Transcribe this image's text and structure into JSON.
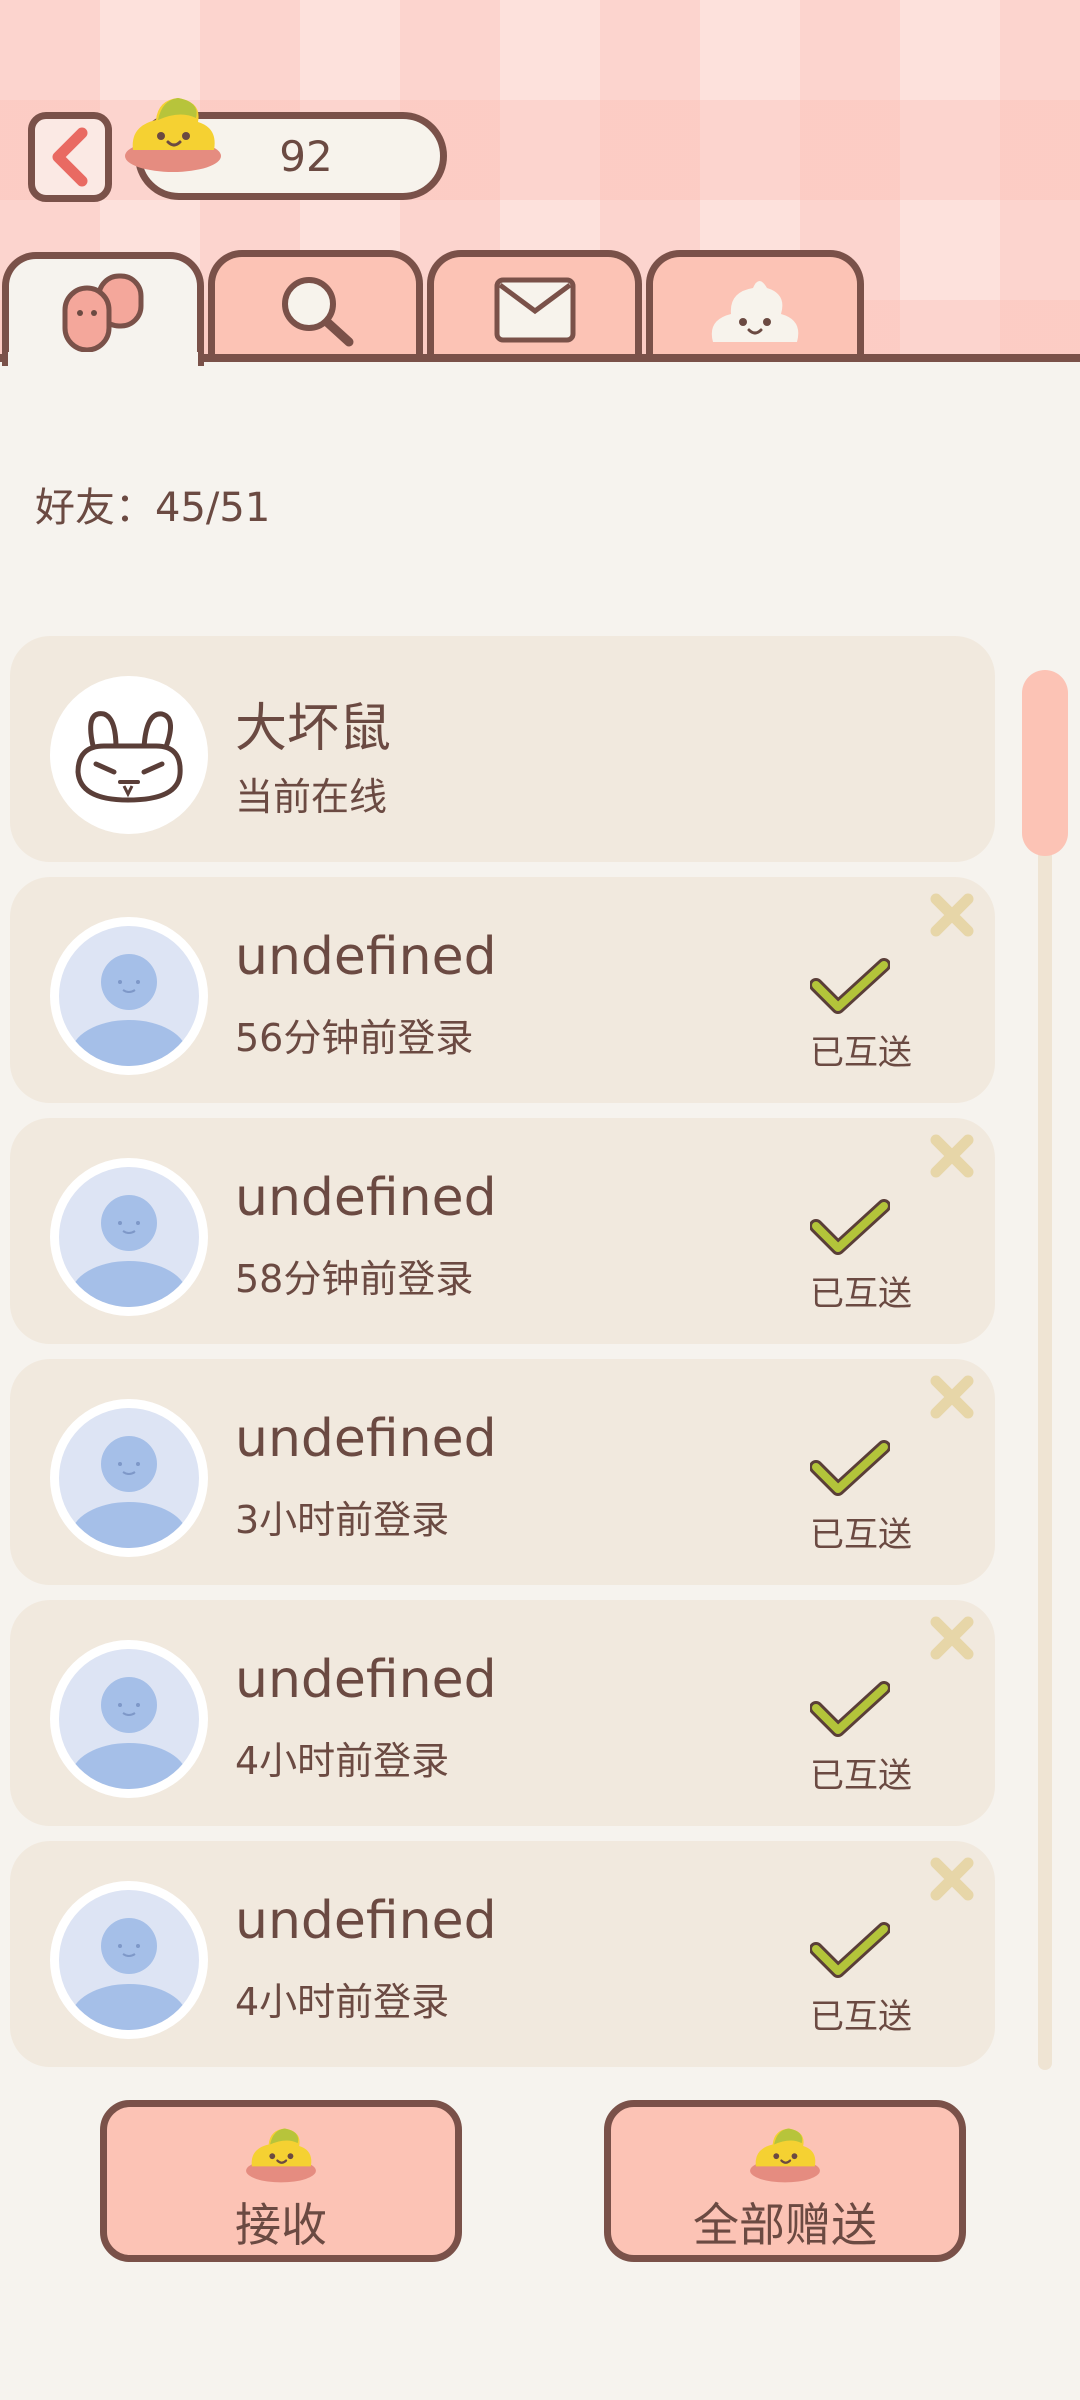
{
  "header": {
    "coins": "92"
  },
  "tabs": [
    {
      "name": "friends",
      "icon": "friends-icon",
      "active": true
    },
    {
      "name": "search",
      "icon": "search-icon",
      "active": false
    },
    {
      "name": "mail",
      "icon": "mail-icon",
      "active": false
    },
    {
      "name": "gift",
      "icon": "blob-icon",
      "active": false
    }
  ],
  "friends_count_label": "好友：45/51",
  "friends": [
    {
      "name": "大坏鼠",
      "status": "当前在线",
      "avatar": "bunny-avatar",
      "sent": false
    },
    {
      "name": "undefined",
      "status": "56分钟前登录",
      "avatar": "default-avatar",
      "sent": true,
      "sent_label": "已互送"
    },
    {
      "name": "undefined",
      "status": "58分钟前登录",
      "avatar": "default-avatar",
      "sent": true,
      "sent_label": "已互送"
    },
    {
      "name": "undefined",
      "status": "3小时前登录",
      "avatar": "default-avatar",
      "sent": true,
      "sent_label": "已互送"
    },
    {
      "name": "undefined",
      "status": "4小时前登录",
      "avatar": "default-avatar",
      "sent": true,
      "sent_label": "已互送"
    },
    {
      "name": "undefined",
      "status": "4小时前登录",
      "avatar": "default-avatar",
      "sent": true,
      "sent_label": "已互送"
    }
  ],
  "actions": {
    "receive_label": "接收",
    "send_all_label": "全部赠送"
  },
  "colors": {
    "accent_pink": "#fcc3b5",
    "outline_brown": "#7a5149",
    "check_green": "#b3c43a",
    "card_bg": "#f1e9de"
  }
}
